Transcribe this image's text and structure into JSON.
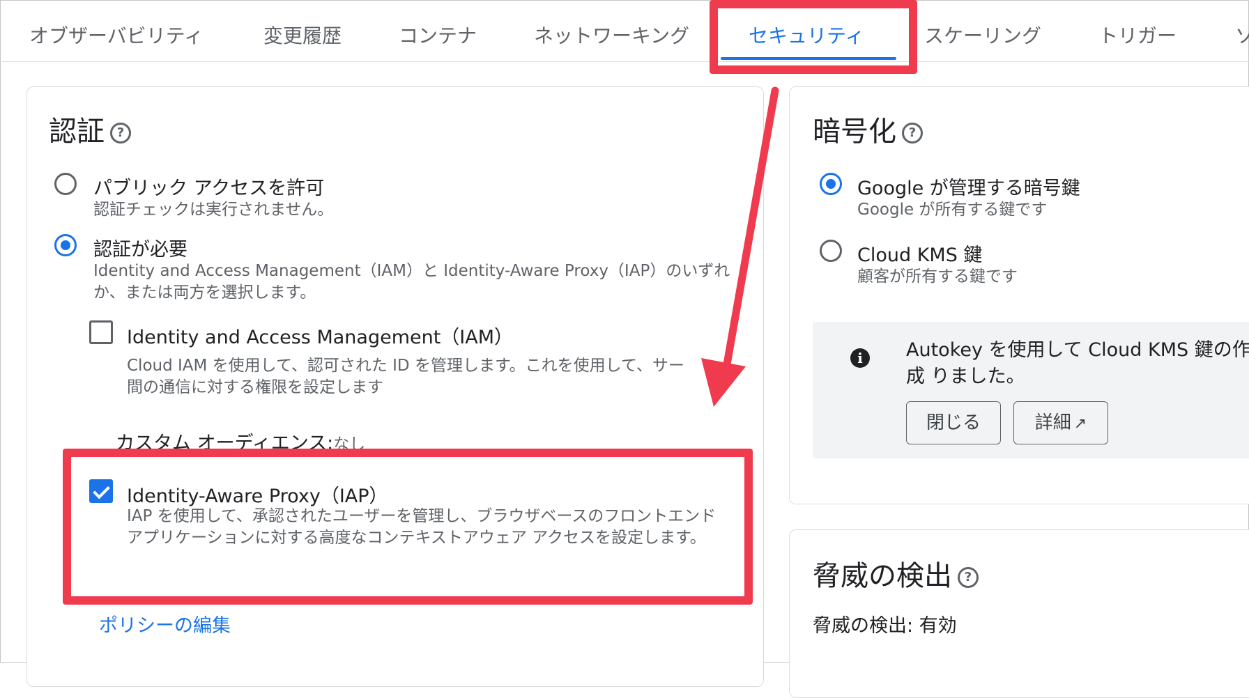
{
  "tabs": [
    {
      "label": "オブザーバビリティ"
    },
    {
      "label": "変更履歴"
    },
    {
      "label": "コンテナ"
    },
    {
      "label": "ネットワーキング"
    },
    {
      "label": "セキュリティ"
    },
    {
      "label": "スケーリング"
    },
    {
      "label": "トリガー"
    },
    {
      "label": "ソ"
    }
  ],
  "auth": {
    "title": "認証",
    "help_glyph": "?",
    "public": {
      "label": "パブリック アクセスを許可",
      "sub": "認証チェックは実行されません。"
    },
    "required": {
      "label": "認証が必要",
      "sub": "Identity and Access Management（IAM）と Identity-Aware Proxy（IAP）のいずれか、または両方を選択します。"
    },
    "iam": {
      "label": "Identity and Access Management（IAM）",
      "sub": "Cloud IAM を使用して、認可された ID を管理します。これを使用して、サー 間の通信に対する権限を設定します"
    },
    "audience_label": "カスタム オーディエンス:",
    "audience_value": "なし",
    "iap": {
      "label": "Identity-Aware Proxy（IAP）",
      "sub": "IAP を使用して、承認されたユーザーを管理し、ブラウザベースのフロントエンド アプリケーションに対する高度なコンテキストアウェア アクセスを設定します。"
    },
    "policy_link": "ポリシーの編集"
  },
  "encryption": {
    "title": "暗号化",
    "help_glyph": "?",
    "google": {
      "label": "Google が管理する暗号鍵",
      "sub": "Google が所有する鍵です"
    },
    "kms": {
      "label": "Cloud KMS 鍵",
      "sub": "顧客が所有する鍵です"
    },
    "info_glyph": "i",
    "info_text": "Autokey を使用して Cloud KMS 鍵の作成 りました。",
    "close_btn": "閉じる",
    "details_btn": "詳細",
    "external_glyph": "↗"
  },
  "threat": {
    "title": "脅威の検出",
    "help_glyph": "?",
    "status": "脅威の検出: 有効"
  },
  "colors": {
    "accent": "#1a73e8",
    "highlight": "#f03a4e"
  }
}
